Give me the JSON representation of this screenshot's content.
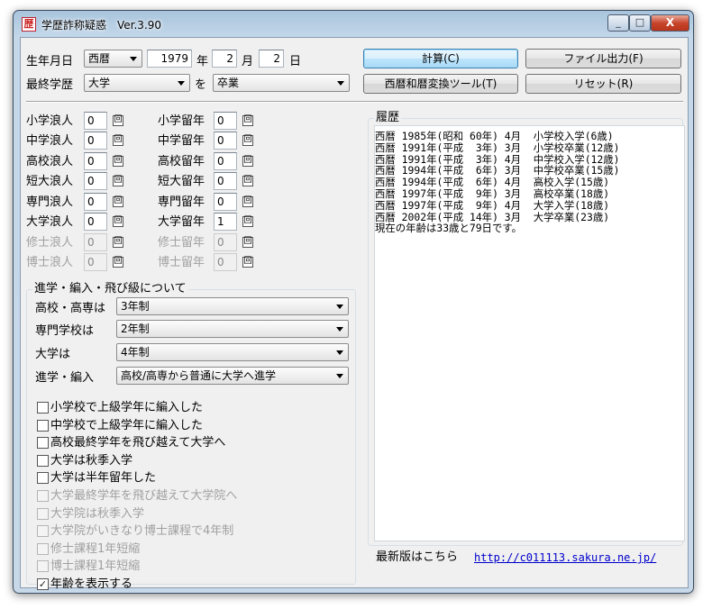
{
  "window": {
    "title": "学歴詐称疑惑　Ver.3.90",
    "minimize": "_",
    "maximize": "□",
    "close": "X",
    "app_icon_glyph": "歴"
  },
  "birth": {
    "label": "生年月日",
    "era": "西暦",
    "year": "1979",
    "year_unit": "年",
    "month": "2",
    "month_unit": "月",
    "day": "2",
    "day_unit": "日"
  },
  "education": {
    "label": "最終学歴",
    "school": "大学",
    "wo": "を",
    "status": "卒業"
  },
  "buttons": {
    "calc": "計算(C)",
    "file_output": "ファイル出力(F)",
    "era_convert": "西暦和暦変換ツール(T)",
    "reset": "リセット(R)"
  },
  "unit_kai": "回",
  "ronin": [
    {
      "label": "小学浪人",
      "value": "0",
      "enabled": true
    },
    {
      "label": "中学浪人",
      "value": "0",
      "enabled": true
    },
    {
      "label": "高校浪人",
      "value": "0",
      "enabled": true
    },
    {
      "label": "短大浪人",
      "value": "0",
      "enabled": true
    },
    {
      "label": "専門浪人",
      "value": "0",
      "enabled": true
    },
    {
      "label": "大学浪人",
      "value": "0",
      "enabled": true
    },
    {
      "label": "修士浪人",
      "value": "0",
      "enabled": false
    },
    {
      "label": "博士浪人",
      "value": "0",
      "enabled": false
    }
  ],
  "ryunen": [
    {
      "label": "小学留年",
      "value": "0",
      "enabled": true
    },
    {
      "label": "中学留年",
      "value": "0",
      "enabled": true
    },
    {
      "label": "高校留年",
      "value": "0",
      "enabled": true
    },
    {
      "label": "短大留年",
      "value": "0",
      "enabled": true
    },
    {
      "label": "専門留年",
      "value": "0",
      "enabled": true
    },
    {
      "label": "大学留年",
      "value": "1",
      "enabled": true
    },
    {
      "label": "修士留年",
      "value": "0",
      "enabled": false
    },
    {
      "label": "博士留年",
      "value": "0",
      "enabled": false
    }
  ],
  "advance": {
    "title": "進学・編入・飛び級について",
    "rows": [
      {
        "label": "高校・高専は",
        "value": "3年制"
      },
      {
        "label": "専門学校は",
        "value": "2年制"
      },
      {
        "label": "大学は",
        "value": "4年制"
      },
      {
        "label": "進学・編入",
        "value": "高校/高専から普通に大学へ進学"
      }
    ],
    "checks": [
      {
        "label": "小学校で上級学年に編入した",
        "checked": false,
        "enabled": true
      },
      {
        "label": "中学校で上級学年に編入した",
        "checked": false,
        "enabled": true
      },
      {
        "label": "高校最終学年を飛び越えて大学へ",
        "checked": false,
        "enabled": true
      },
      {
        "label": "大学は秋季入学",
        "checked": false,
        "enabled": true
      },
      {
        "label": "大学は半年留年した",
        "checked": false,
        "enabled": true
      },
      {
        "label": "大学最終学年を飛び越えて大学院へ",
        "checked": false,
        "enabled": false
      },
      {
        "label": "大学院は秋季入学",
        "checked": false,
        "enabled": false
      },
      {
        "label": "大学院がいきなり博士課程で4年制",
        "checked": false,
        "enabled": false
      },
      {
        "label": "修士課程1年短縮",
        "checked": false,
        "enabled": false
      },
      {
        "label": "博士課程1年短縮",
        "checked": false,
        "enabled": false
      },
      {
        "label": "年齢を表示する",
        "checked": true,
        "enabled": true
      }
    ]
  },
  "history": {
    "title": "履歴",
    "lines": [
      "西暦 1985年(昭和 60年) 4月  小学校入学(6歳)",
      "西暦 1991年(平成  3年) 3月  小学校卒業(12歳)",
      "西暦 1991年(平成  3年) 4月  中学校入学(12歳)",
      "西暦 1994年(平成  6年) 3月  中学校卒業(15歳)",
      "西暦 1994年(平成  6年) 4月  高校入学(15歳)",
      "西暦 1997年(平成  9年) 3月  高校卒業(18歳)",
      "西暦 1997年(平成  9年) 4月  大学入学(18歳)",
      "西暦 2002年(平成 14年) 3月  大学卒業(23歳)",
      "現在の年齢は33歳と79日です。"
    ]
  },
  "footer": {
    "latest": "最新版はこちら",
    "url": "http://c011113.sakura.ne.jp/"
  }
}
